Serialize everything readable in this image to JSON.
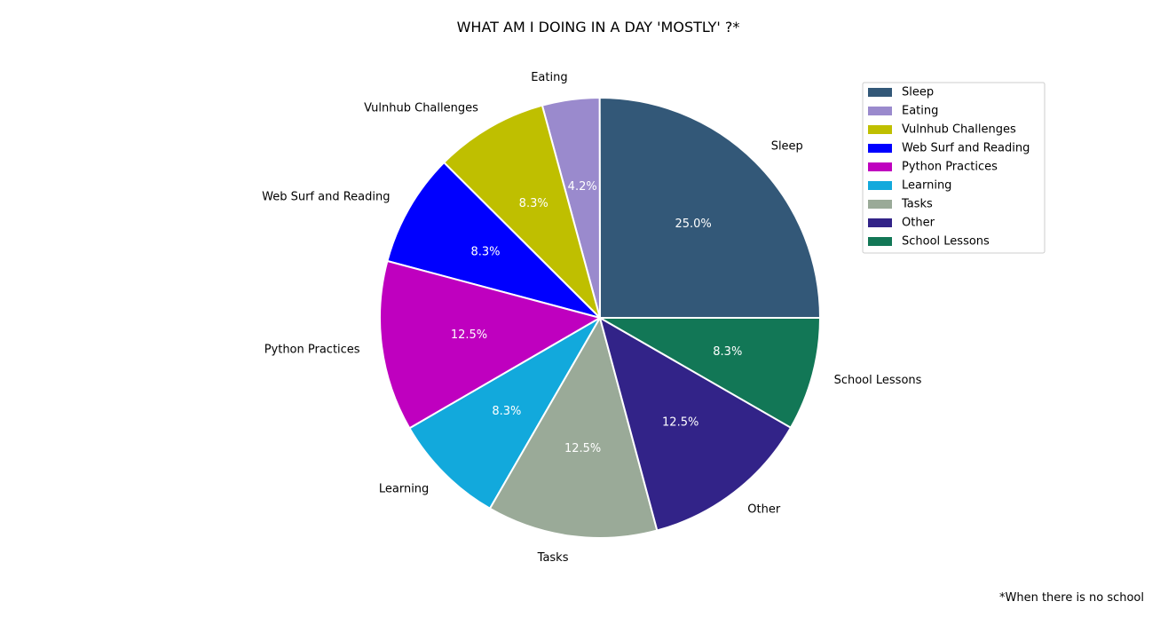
{
  "chart_data": {
    "type": "pie",
    "title": "WHAT AM I DOING IN A DAY 'MOSTLY' ?*",
    "footnote": "*When there is no school",
    "legend_position": "top-right",
    "slices": [
      {
        "label": "Sleep",
        "value": 25.0,
        "pct_label": "25.0%",
        "color": "#335878"
      },
      {
        "label": "Eating",
        "value": 4.2,
        "pct_label": "4.2%",
        "color": "#9a8acd"
      },
      {
        "label": "Vulnhub Challenges",
        "value": 8.3,
        "pct_label": "8.3%",
        "color": "#bfbf00"
      },
      {
        "label": "Web Surf and Reading",
        "value": 8.3,
        "pct_label": "8.3%",
        "color": "#0000ff"
      },
      {
        "label": "Python Practices",
        "value": 12.5,
        "pct_label": "12.5%",
        "color": "#bf00bf"
      },
      {
        "label": "Learning",
        "value": 8.3,
        "pct_label": "8.3%",
        "color": "#12a9dc"
      },
      {
        "label": "Tasks",
        "value": 12.5,
        "pct_label": "12.5%",
        "color": "#9aaa98"
      },
      {
        "label": "Other",
        "value": 12.5,
        "pct_label": "12.5%",
        "color": "#322388"
      },
      {
        "label": "School Lessons",
        "value": 8.3,
        "pct_label": "8.3%",
        "color": "#127756"
      }
    ]
  }
}
